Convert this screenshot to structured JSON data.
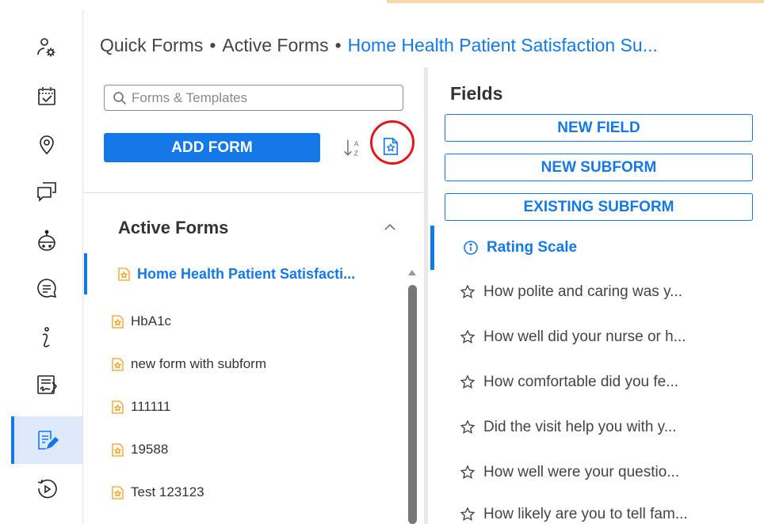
{
  "breadcrumb": {
    "items": [
      "Quick Forms",
      "Active Forms"
    ],
    "separator": "•",
    "current": "Home Health Patient Satisfaction Su..."
  },
  "rail": {
    "items": [
      {
        "icon": "user-settings-icon",
        "active": false
      },
      {
        "icon": "calendar-check-icon",
        "active": false
      },
      {
        "icon": "location-pin-icon",
        "active": false
      },
      {
        "icon": "chat-bubbles-icon",
        "active": false
      },
      {
        "icon": "bot-icon",
        "active": false
      },
      {
        "icon": "message-icon",
        "active": false
      },
      {
        "icon": "info-icon",
        "active": false
      },
      {
        "icon": "signed-document-icon",
        "active": false
      },
      {
        "icon": "form-edit-icon",
        "active": true
      },
      {
        "icon": "history-icon",
        "active": false
      }
    ]
  },
  "forms_panel": {
    "search_placeholder": "Forms & Templates",
    "add_form_label": "ADD FORM",
    "section_title": "Active Forms",
    "forms": [
      {
        "name": "Home Health Patient Satisfacti...",
        "active": true
      },
      {
        "name": "HbA1c",
        "active": false
      },
      {
        "name": "new form with subform",
        "active": false
      },
      {
        "name": "111111",
        "active": false
      },
      {
        "name": "19588",
        "active": false
      },
      {
        "name": "Test 123123",
        "active": false
      }
    ]
  },
  "fields_panel": {
    "title": "Fields",
    "new_field_label": "NEW FIELD",
    "new_subform_label": "NEW SUBFORM",
    "existing_subform_label": "EXISTING SUBFORM",
    "fields": [
      {
        "label": "Rating Scale",
        "icon": "info-circle-icon",
        "active": true
      },
      {
        "label": "How polite and caring was y...",
        "icon": "star-icon",
        "active": false
      },
      {
        "label": "How well did your nurse or h...",
        "icon": "star-icon",
        "active": false
      },
      {
        "label": "How comfortable did you fe...",
        "icon": "star-icon",
        "active": false
      },
      {
        "label": "Did the visit help you with y...",
        "icon": "star-icon",
        "active": false
      },
      {
        "label": "How well were your questio...",
        "icon": "star-icon",
        "active": false
      },
      {
        "label": "How likely are you to tell fam...",
        "icon": "star-icon",
        "active": false
      }
    ]
  },
  "colors": {
    "accent": "#1479e6",
    "highlight_circle": "#e0171d",
    "active_rail_bg": "#dde9fb",
    "form_icon": "#f0a020"
  }
}
